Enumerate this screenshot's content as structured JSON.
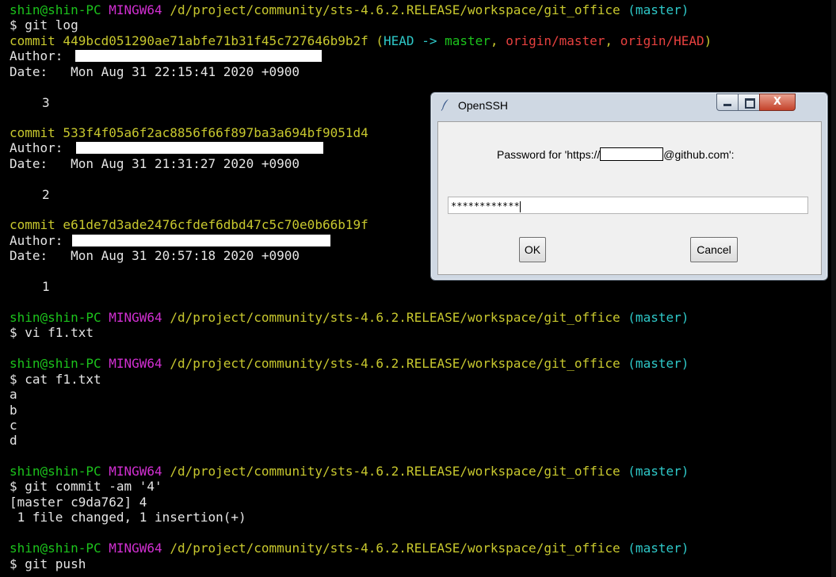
{
  "terminal": {
    "prompt": {
      "user_host": "shin@shin-PC",
      "env": "MINGW64",
      "path": "/d/project/community/sts-4.6.2.RELEASE/workspace/git_office",
      "branch": "(master)"
    },
    "cmd_git_log": "$ git log",
    "commits": [
      {
        "hash_line": "commit 449bcd051290ae71abfe71b31f45c727646b9b2f",
        "refs_open": "(",
        "head": "HEAD ->",
        "head_branch": "master",
        "sep1": ",",
        "origin_master": "origin/master",
        "sep2": ",",
        "origin_head": "origin/HEAD",
        "refs_close": ")",
        "author_label": "Author:",
        "date_line": "Date:   Mon Aug 31 22:15:41 2020 +0900",
        "message": "3"
      },
      {
        "hash_line": "commit 533f4f05a6f2ac8856f66f897ba3a694bf9051d4",
        "author_label": "Author:",
        "date_line": "Date:   Mon Aug 31 21:31:27 2020 +0900",
        "message": "2"
      },
      {
        "hash_line": "commit e61de7d3ade2476cfdef6dbd47c5c70e0b66b19f",
        "author_label": "Author:",
        "date_line": "Date:   Mon Aug 31 20:57:18 2020 +0900",
        "message": "1"
      }
    ],
    "cmd_vi": "$ vi f1.txt",
    "cmd_cat": "$ cat f1.txt",
    "file_lines": [
      "a",
      "b",
      "c",
      "d"
    ],
    "cmd_commit": "$ git commit -am '4'",
    "commit_out1": "[master c9da762] 4",
    "commit_out2": " 1 file changed, 1 insertion(+)",
    "cmd_push": "$ git push"
  },
  "dialog": {
    "title": "OpenSSH",
    "minimize_glyph": "",
    "maximize_glyph": "",
    "close_glyph": "X",
    "prompt_before": "Password for 'https://",
    "prompt_after": "@github.com':",
    "password_value": "************",
    "ok_label": "OK",
    "cancel_label": "Cancel"
  },
  "colors": {
    "prompt_user": "#1cc31c",
    "prompt_env": "#d22fd2",
    "prompt_path": "#c8c82e",
    "prompt_branch": "#2ec8c8",
    "ref_remote": "#e8413f",
    "commit_hash": "#c8c82e"
  }
}
